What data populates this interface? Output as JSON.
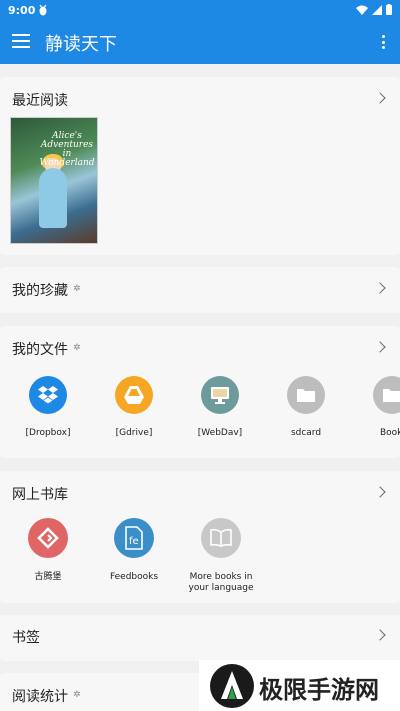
{
  "status_bar": {
    "time": "9:00",
    "bug_icon": "debug-bug-icon"
  },
  "app_bar": {
    "title": "静读天下"
  },
  "recent": {
    "title": "最近阅读",
    "book": {
      "cover_text": "Alice's Adventures in Wonderland"
    }
  },
  "favorites": {
    "title": "我的珍藏"
  },
  "my_files": {
    "title": "我的文件",
    "items": [
      {
        "label": "[Dropbox]",
        "color": "#1e88e5",
        "icon": "dropbox-icon"
      },
      {
        "label": "[Gdrive]",
        "color": "#f5a623",
        "icon": "gdrive-icon"
      },
      {
        "label": "[WebDav]",
        "color": "#6d9a9a",
        "icon": "webdav-computer-icon"
      },
      {
        "label": "sdcard",
        "color": "#bdbdbd",
        "icon": "folder-icon"
      },
      {
        "label": "Book",
        "color": "#bdbdbd",
        "icon": "folder-icon"
      }
    ]
  },
  "online_library": {
    "title": "网上书库",
    "items": [
      {
        "label": "古腾堡",
        "color": "#e06666",
        "icon": "gutenberg-icon"
      },
      {
        "label": "Feedbooks",
        "color": "#3a8fc9",
        "icon": "feedbooks-icon"
      },
      {
        "label": "More books in your language",
        "color": "#c8c8c8",
        "icon": "open-book-icon"
      }
    ]
  },
  "bookmarks": {
    "title": "书签"
  },
  "reading_stats": {
    "title": "阅读统计"
  },
  "watermark": {
    "text": "极限手游网"
  }
}
